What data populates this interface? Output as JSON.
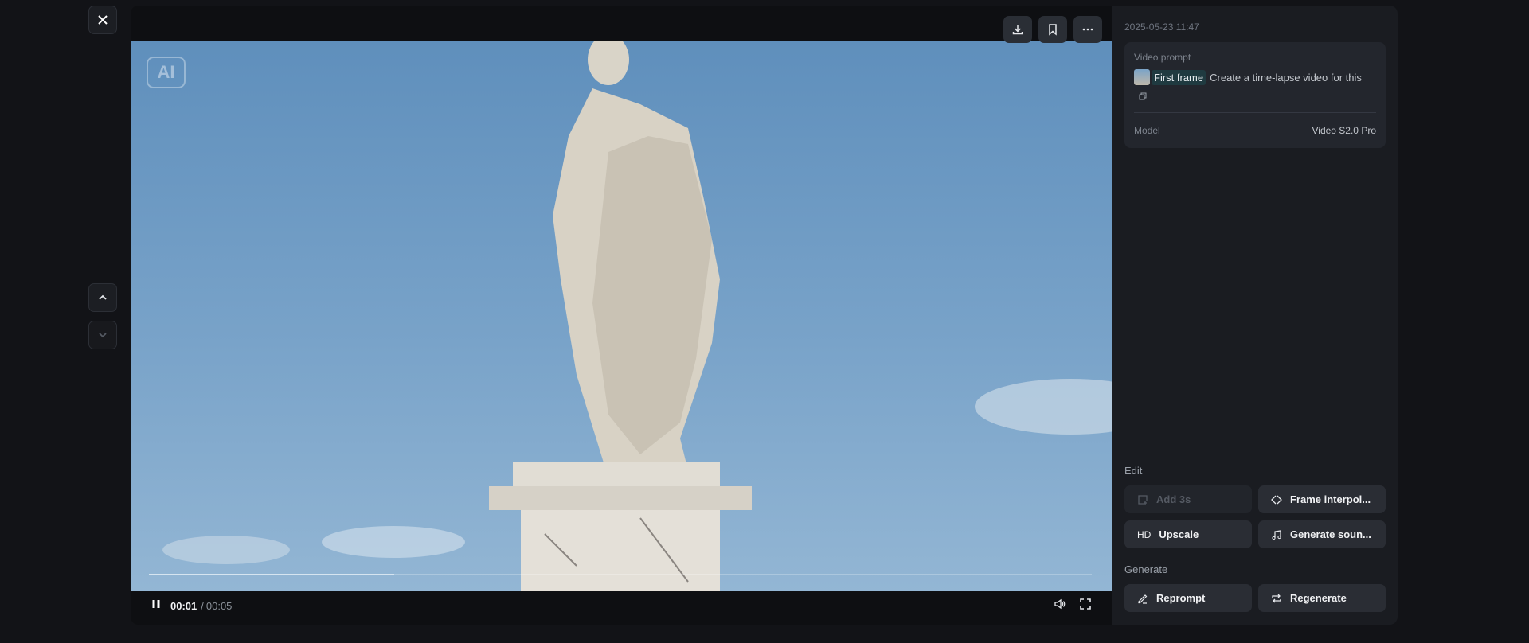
{
  "nav": {
    "close": "close-icon",
    "up": "chevron-up-icon",
    "down": "chevron-down-icon"
  },
  "video": {
    "ai_badge": "AI",
    "current_time": "00:01",
    "separator": "/",
    "duration": "00:05",
    "progress_fraction": 0.26,
    "toolbar": [
      "download-icon",
      "bookmark-icon",
      "more-icon"
    ]
  },
  "panel": {
    "timestamp": "2025-05-23 11:47",
    "prompt_label": "Video prompt",
    "first_frame_tag": "First frame",
    "prompt_text": "Create a time-lapse video for this",
    "model_label": "Model",
    "model_value": "Video S2.0 Pro",
    "edit_label": "Edit",
    "add3s": "Add 3s",
    "frame_interp": "Frame interpol...",
    "upscale_icon": "HD",
    "upscale": "Upscale",
    "gen_sound": "Generate soun...",
    "generate_label": "Generate",
    "reprompt": "Reprompt",
    "regenerate": "Regenerate"
  }
}
